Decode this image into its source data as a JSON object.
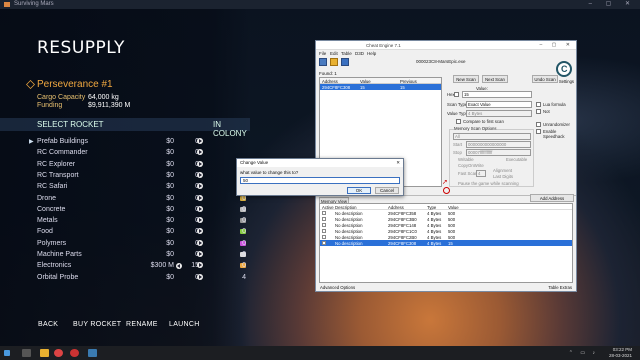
{
  "game": {
    "window_title": "Surviving Mars",
    "title": "RESUPPLY",
    "rocket_name": "Perseverance #1",
    "cargo_capacity_label": "Cargo Capacity",
    "cargo_capacity_value": "64,000 kg",
    "funding_label": "Funding",
    "funding_value": "$9,911,390 M",
    "select_rocket_label": "SELECT ROCKET",
    "in_colony_label": "IN COLONY",
    "items": [
      {
        "name": "Prefab Buildings",
        "price": "$0",
        "qty": "0",
        "colony": ""
      },
      {
        "name": "RC Commander",
        "price": "$0",
        "qty": "0",
        "colony": ""
      },
      {
        "name": "RC Explorer",
        "price": "$0",
        "qty": "0",
        "colony": ""
      },
      {
        "name": "RC Transport",
        "price": "$0",
        "qty": "0",
        "colony": ""
      },
      {
        "name": "RC Safari",
        "price": "$0",
        "qty": "0",
        "colony": ""
      },
      {
        "name": "Drone",
        "price": "$0",
        "qty": "0",
        "colony": "0"
      },
      {
        "name": "Concrete",
        "price": "$0",
        "qty": "0",
        "colony": "0"
      },
      {
        "name": "Metals",
        "price": "$0",
        "qty": "0",
        "colony": "0"
      },
      {
        "name": "Food",
        "price": "$0",
        "qty": "0",
        "colony": "0"
      },
      {
        "name": "Polymers",
        "price": "$0",
        "qty": "0",
        "colony": "0"
      },
      {
        "name": "Machine Parts",
        "price": "$0",
        "qty": "0",
        "colony": "0"
      },
      {
        "name": "Electronics",
        "price": "$300 M",
        "qty": "15",
        "colony": "0"
      },
      {
        "name": "Orbital Probe",
        "price": "$0",
        "qty": "0",
        "colony": "4"
      }
    ],
    "bottom_buttons": [
      "BACK",
      "BUY ROCKET",
      "RENAME",
      "LAUNCH"
    ],
    "colors": {
      "accent": "#f0a840"
    }
  },
  "cheat_engine": {
    "title": "Cheat Engine 7.1",
    "menu": [
      "File",
      "Edit",
      "Table",
      "D3D",
      "Help"
    ],
    "process": "000023C8-MarsEpic.exe",
    "found": "Found: 1",
    "list_headers": [
      "Address",
      "Value",
      "Previous"
    ],
    "list_rows": [
      {
        "address": "294CF8FC308",
        "value": "15",
        "previous": "15"
      }
    ],
    "new_scan": "New Scan",
    "next_scan": "Next Scan",
    "undo_scan": "Undo Scan",
    "settings": "Settings",
    "value_label": "Value:",
    "hex_label": "Hex",
    "hex_value": "15",
    "scan_type_label": "Scan Type",
    "scan_type_value": "Exact Value",
    "value_type_label": "Value Type",
    "value_type_value": "4 Bytes",
    "lua_formula": "Lua formula",
    "not_label": "Not",
    "compare_first": "Compare to first scan",
    "memory_scan_options": "Memory Scan Options",
    "mem_region": "All",
    "start_label": "Start",
    "start_value": "0000000000000000",
    "stop_label": "Stop",
    "stop_value": "00007fffffffffff",
    "writable": "Writable",
    "executable": "Executable",
    "copy_on_write": "CopyOnWrite",
    "fast_scan": "Fast Scan",
    "fast_scan_value": "4",
    "alignment": "Alignment",
    "last_digits": "Last Digits",
    "pause_game": "Pause the game while scanning",
    "unrandomizer": "Unrandomizer",
    "enable_speedhack": "Enable Speedhack",
    "memory_view": "Memory View",
    "add_address": "Add Address Manually",
    "table_headers": [
      "Active",
      "Description",
      "Address",
      "Type",
      "Value"
    ],
    "table_rows": [
      {
        "desc": "No description",
        "address": "294CF8FC358",
        "type": "4 Bytes",
        "value": "500"
      },
      {
        "desc": "No description",
        "address": "294CF8FC3B0",
        "type": "4 Bytes",
        "value": "500"
      },
      {
        "desc": "No description",
        "address": "294CF8FC148",
        "type": "4 Bytes",
        "value": "500"
      },
      {
        "desc": "No description",
        "address": "294CF8FC1C0",
        "type": "4 Bytes",
        "value": "500"
      },
      {
        "desc": "No description",
        "address": "294CF8FC2B0",
        "type": "4 Bytes",
        "value": "500"
      },
      {
        "desc": "No description",
        "address": "294CF8FC308",
        "type": "4 Bytes",
        "value": "15"
      }
    ],
    "advanced_options": "Advanced Options",
    "table_extras": "Table Extras"
  },
  "dialog": {
    "title": "Change Value",
    "question": "what value to change this to?",
    "input_value": "50",
    "ok": "OK",
    "cancel": "Cancel"
  },
  "taskbar": {
    "time": "03:22 PM",
    "date": "28-03-2021"
  }
}
